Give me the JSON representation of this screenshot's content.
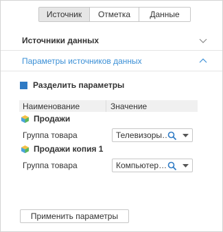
{
  "tabs": [
    {
      "label": "Источник",
      "active": true
    },
    {
      "label": "Отметка",
      "active": false
    },
    {
      "label": "Данные",
      "active": false
    }
  ],
  "sections": {
    "data_sources": {
      "label": "Источники данных",
      "expanded": false
    },
    "source_params": {
      "label": "Параметры источников данных",
      "expanded": true
    }
  },
  "split_params": {
    "label": "Разделить параметры",
    "checked": true
  },
  "grid": {
    "columns": [
      "Наименование",
      "Значение"
    ],
    "sources": [
      {
        "name": "Продажи",
        "icon": "cube-icon",
        "params": [
          {
            "name": "Группа товара",
            "value": "Телевизоры…"
          }
        ]
      },
      {
        "name": "Продажи копия 1",
        "icon": "cube-icon",
        "params": [
          {
            "name": "Группа товара",
            "value": "Компьютер…"
          }
        ]
      }
    ]
  },
  "apply_button": "Применить параметры",
  "colors": {
    "accent": "#3a8fd6",
    "checkbox": "#2e7ac4",
    "border": "#c6c6c6"
  }
}
